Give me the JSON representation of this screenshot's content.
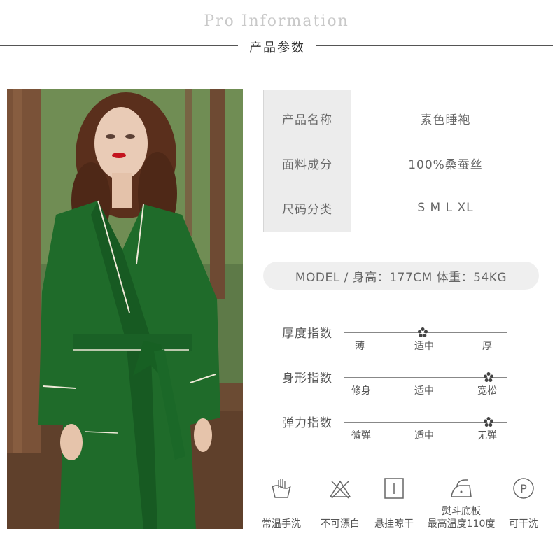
{
  "header": {
    "title_en": "Pro Information",
    "title_cn": "产品参数"
  },
  "specs": [
    {
      "key": "产品名称",
      "value": "素色睡袍"
    },
    {
      "key": "面料成分",
      "value": "100%桑蚕丝"
    },
    {
      "key": "尺码分类",
      "value": "S M L XL"
    }
  ],
  "model": {
    "text": "MODEL / 身高：177CM 体重：54KG"
  },
  "indices": [
    {
      "label": "厚度指数",
      "ticks": [
        "薄",
        "适中",
        "厚"
      ],
      "selected_index": 1
    },
    {
      "label": "身形指数",
      "ticks": [
        "修身",
        "适中",
        "宽松"
      ],
      "selected_index": 2
    },
    {
      "label": "弹力指数",
      "ticks": [
        "微弹",
        "适中",
        "无弹"
      ],
      "selected_index": 2
    }
  ],
  "care": [
    {
      "icon": "hand-wash-icon",
      "label": "常温手洗"
    },
    {
      "icon": "no-bleach-icon",
      "label": "不可漂白"
    },
    {
      "icon": "line-dry-icon",
      "label": "悬挂晾干"
    },
    {
      "icon": "iron-icon",
      "label_line1": "熨斗底板",
      "label_line2": "最高温度110度"
    },
    {
      "icon": "dry-clean-icon",
      "label": "可干洗"
    }
  ],
  "colors": {
    "robe": "#1f6b2a",
    "marker": "#444444"
  }
}
